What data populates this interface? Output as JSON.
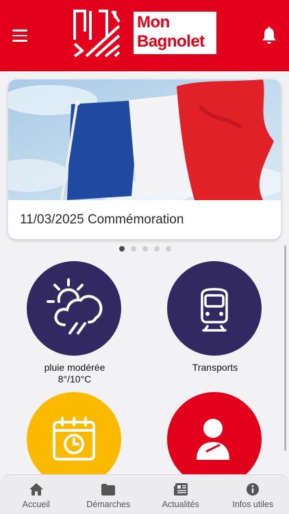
{
  "header": {
    "logo_line1": "Mon",
    "logo_line2": "Bagnolet",
    "brand_color": "#e2001a"
  },
  "carousel": {
    "slides": [
      {
        "caption": "11/03/2025 Commémoration"
      }
    ],
    "dot_count": 5,
    "active_index": 0
  },
  "tiles": {
    "weather": {
      "condition": "pluie modérée",
      "temps": "8°/10°C",
      "color": "#332962",
      "icon": "sun-cloud-rain-icon"
    },
    "transports": {
      "label": "Transports",
      "color": "#332962",
      "icon": "tram-icon"
    },
    "agenda": {
      "color": "#fbb900",
      "icon": "calendar-clock-icon"
    },
    "profile": {
      "color": "#e2001a",
      "icon": "user-icon"
    }
  },
  "tabbar": {
    "items": [
      {
        "label": "Accueil",
        "icon": "home-icon"
      },
      {
        "label": "Démarches",
        "icon": "folder-icon"
      },
      {
        "label": "Actualités",
        "icon": "newspaper-icon"
      },
      {
        "label": "Infos utiles",
        "icon": "info-icon"
      }
    ]
  }
}
